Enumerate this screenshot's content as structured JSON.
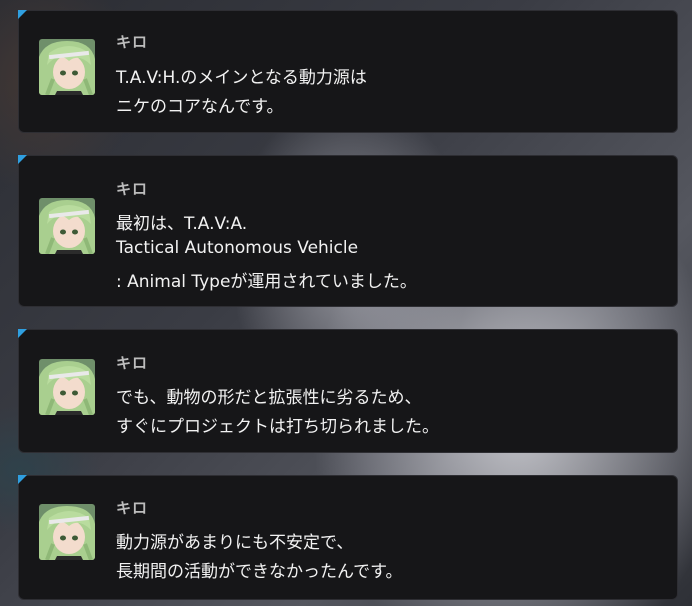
{
  "dialogue": [
    {
      "speaker": "キロ",
      "lines": [
        "T.A.V:H.のメインとなる動力源は",
        "ニケのコアなんです。"
      ]
    },
    {
      "speaker": "キロ",
      "lines": [
        "最初は、T.A.V:A.",
        "Tactical Autonomous Vehicle",
        ": Animal Typeが運用されていました。"
      ]
    },
    {
      "speaker": "キロ",
      "lines": [
        "でも、動物の形だと拡張性に劣るため、",
        "すぐにプロジェクトは打ち切られました。"
      ]
    },
    {
      "speaker": "キロ",
      "lines": [
        "動力源があまりにも不安定で、",
        "長期間の活動ができなかったんです。"
      ]
    }
  ],
  "icons": {
    "avatar": "kilo-portrait-icon",
    "corner": "blue-corner-marker"
  },
  "colors": {
    "accent": "#2f9fe0",
    "bubble_bg": "#161618",
    "text": "#f2f2f2",
    "speaker": "#bdbdbd",
    "hair": "#a9cf8f"
  }
}
